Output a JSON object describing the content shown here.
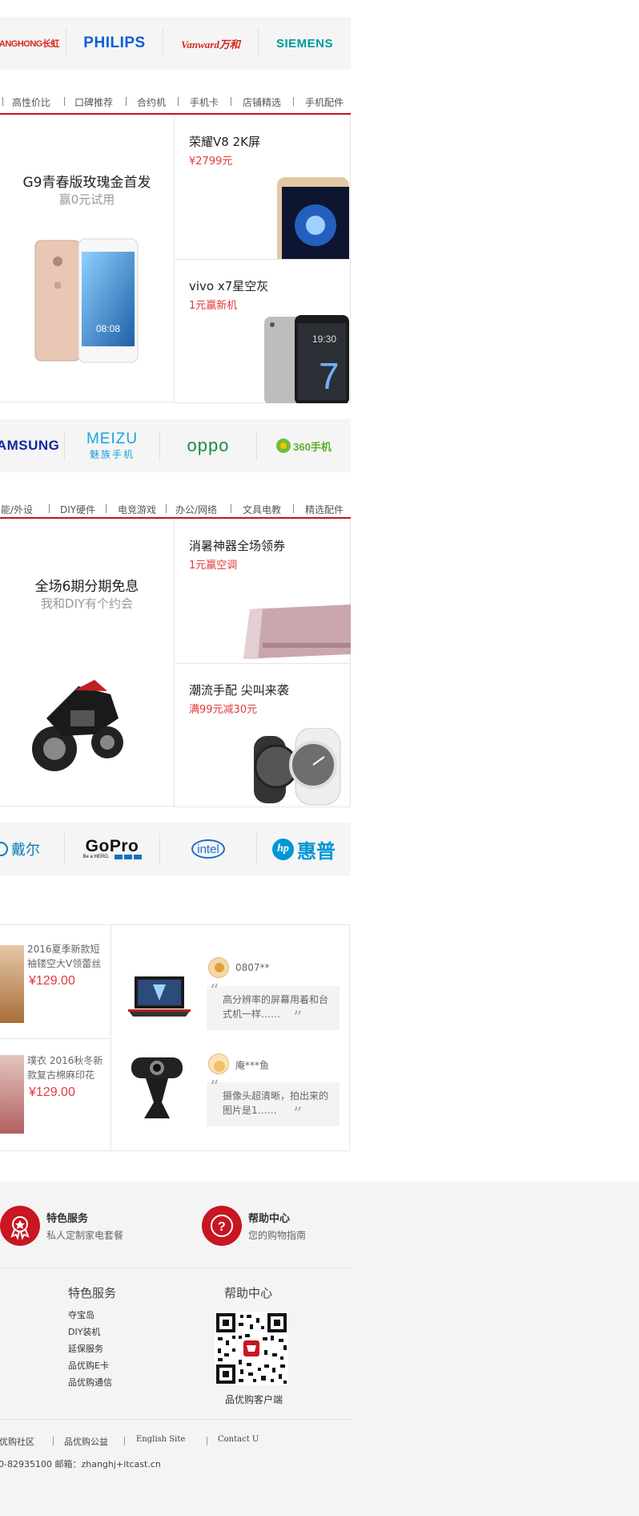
{
  "brand_rows": [
    {
      "brands": [
        "CHANGHONG长虹",
        "PHILIPS",
        "Vanward万和",
        "SIEMENS"
      ]
    },
    {
      "brands": [
        "SAMSUNG",
        "MEIZU",
        "魅族手机",
        "oppo",
        "360手机"
      ]
    },
    {
      "brands": [
        "戴尔",
        "GoPro",
        "Be a HERO.",
        "intel",
        "惠普"
      ]
    }
  ],
  "phone_section": {
    "tabs": [
      "高性价比",
      "口碑推荐",
      "合约机",
      "手机卡",
      "店铺精选",
      "手机配件"
    ],
    "banner": {
      "title": "G9青春版玫瑰金首发",
      "subtitle": "赢0元试用"
    },
    "items": [
      {
        "title": "荣耀V8 2K屏",
        "subtitle": "¥2799元"
      },
      {
        "title": "vivo x7星空灰",
        "subtitle": "1元赢新机"
      }
    ]
  },
  "digital_section": {
    "tabs": [
      "智能/外设",
      "DIY硬件",
      "电竞游戏",
      "办公/网络",
      "文具电教",
      "精选配件"
    ],
    "banner": {
      "title": "全场6期分期免息",
      "subtitle": "我和DIY有个约会"
    },
    "items": [
      {
        "title": "消暑神器全场领券",
        "subtitle": "1元赢空调"
      },
      {
        "title": "潮流手配 尖叫来袭",
        "subtitle": "满99元减30元"
      }
    ]
  },
  "reviews": {
    "products": [
      {
        "desc": "2016夏季新款短袖镂空大V领蕾丝",
        "price": "¥129.00"
      },
      {
        "desc": "璞衣 2016秋冬新款复古棉麻印花",
        "price": "¥129.00"
      }
    ],
    "comments": [
      {
        "user": "0807**",
        "text": "高分辨率的屏幕用着和台式机一样……"
      },
      {
        "user": "庵***鱼",
        "text": "摄像头超清晰，拍出来的图片是1……"
      }
    ]
  },
  "footer": {
    "services": [
      {
        "title": "特色服务",
        "subtitle": "私人定制家电套餐"
      },
      {
        "title": "帮助中心",
        "subtitle": "您的购物指南"
      }
    ],
    "col1": {
      "heading": "特色服务",
      "links": [
        "夺宝岛",
        "DIY装机",
        "延保服务",
        "品优购E卡",
        "品优购通信"
      ]
    },
    "col2": {
      "heading": "帮助中心",
      "qr_caption": "品优购客户端"
    },
    "bottom_links": [
      "品优购社区",
      "品优购公益",
      "English Site",
      "Contact U"
    ],
    "contact": "0-82935100 邮箱：zhanghj+itcast.cn"
  },
  "colors": {
    "accent": "#c81623",
    "price": "#e4393c"
  }
}
